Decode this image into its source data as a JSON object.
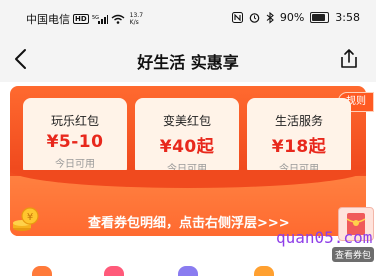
{
  "status": {
    "carrier": "中国电信",
    "hd": "HD",
    "signal": "5G",
    "speed_value": "13.7",
    "speed_unit": "K/s",
    "battery": "90%",
    "time": "3:58"
  },
  "nav": {
    "title": "好生活 实惠享"
  },
  "banner": {
    "rules_label": "规则",
    "coupons": [
      {
        "name": "玩乐红包",
        "amount": "¥5-10",
        "availability": "今日可用"
      },
      {
        "name": "变美红包",
        "amount": "¥40起",
        "availability": "今日可用"
      },
      {
        "name": "生活服务",
        "amount": "¥18起",
        "availability": "今日可用"
      }
    ],
    "hint": "查看券包明细，点击右侧浮层>>>"
  },
  "float_widget": {
    "label": "查看券包"
  },
  "watermark": "quan05.com",
  "colors": {
    "accent": "#f04a1e",
    "price_red": "#e8281c",
    "coupon_bg": "#fff3e8",
    "watermark": "#8e3ee8"
  }
}
